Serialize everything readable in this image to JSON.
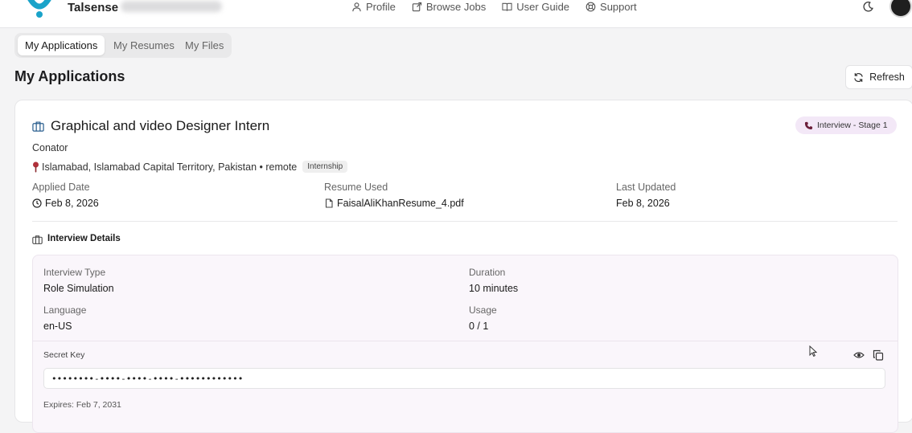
{
  "brand": {
    "name": "Talsense"
  },
  "nav": {
    "links": [
      "Profile",
      "Browse Jobs",
      "User Guide",
      "Support"
    ]
  },
  "tabs": [
    "My Applications",
    "My Resumes",
    "My Files"
  ],
  "page": {
    "title": "My Applications",
    "refresh_label": "Refresh"
  },
  "application": {
    "title": "Graphical and video Designer Intern",
    "stage": "Interview - Stage 1",
    "company": "Conator",
    "location": "Islamabad, Islamabad Capital Territory, Pakistan • remote",
    "job_type": "Internship",
    "applied_label": "Applied Date",
    "applied_date": "Feb 8, 2026",
    "resume_label": "Resume Used",
    "resume_file": "FaisalAliKhanResume_4.pdf",
    "updated_label": "Last Updated",
    "updated_date": "Feb 8, 2026"
  },
  "interview": {
    "heading": "Interview Details",
    "type_label": "Interview Type",
    "type_value": "Role Simulation",
    "duration_label": "Duration",
    "duration_value": "10 minutes",
    "language_label": "Language",
    "language_value": "en-US",
    "usage_label": "Usage",
    "usage_value": "0 / 1",
    "secret_label": "Secret Key",
    "secret_value": "••••••••-••••-••••-••••-••••••••••••",
    "expires": "Expires: Feb 7, 2031"
  },
  "colors": {
    "accent": "#1aa3c9",
    "badge_bg": "#f3e8f7",
    "panel_bg": "#faf6fb"
  }
}
